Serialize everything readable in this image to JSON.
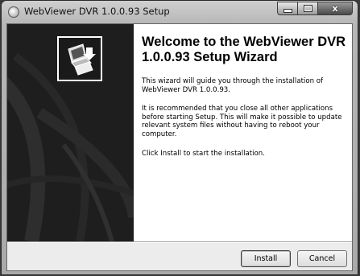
{
  "window": {
    "title": "WebViewer DVR 1.0.0.93 Setup",
    "controls": {
      "minimize_icon": "minimize-icon",
      "maximize_icon": "maximize-icon",
      "close_glyph": "x"
    }
  },
  "sidebar": {
    "logo_icon": "installer-computer-icon",
    "background": "#1e1e1e"
  },
  "main": {
    "heading": "Welcome to the WebViewer DVR 1.0.0.93 Setup Wizard",
    "paragraph1": "This wizard will guide you through the installation of\nWebViewer DVR 1.0.0.93.",
    "paragraph2": "It is recommended that you close all other applications\nbefore starting Setup. This will make it possible to update\nrelevant system files without having to reboot your\ncomputer.",
    "paragraph3": "Click Install to start the installation."
  },
  "footer": {
    "install_label": "Install",
    "cancel_label": "Cancel"
  }
}
